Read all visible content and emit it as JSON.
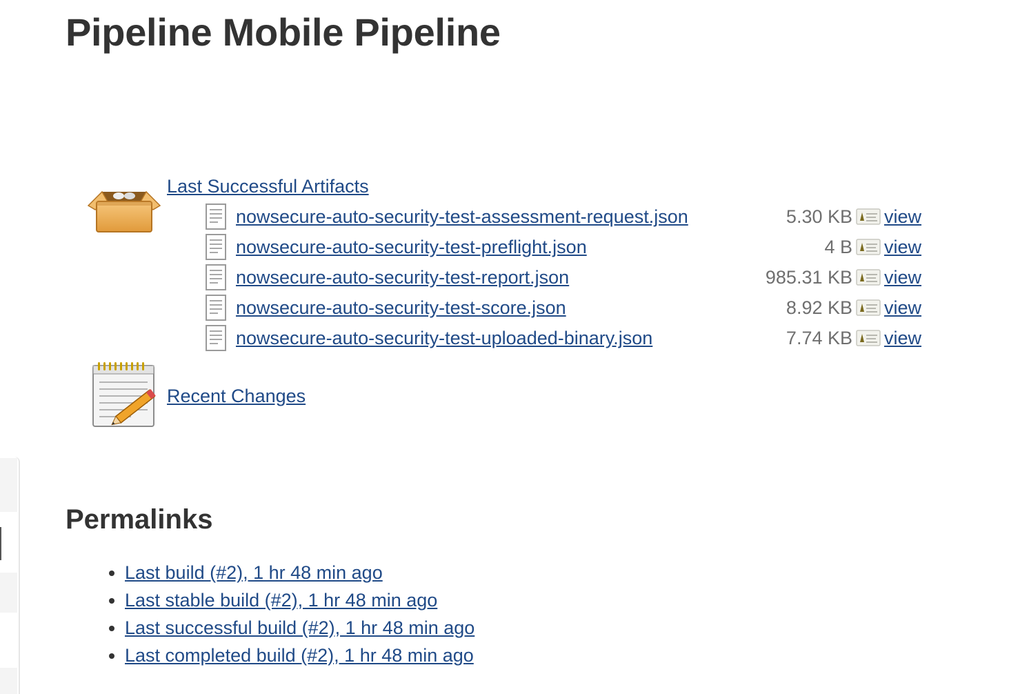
{
  "page": {
    "title": "Pipeline Mobile Pipeline"
  },
  "artifacts": {
    "section_label": "Last Successful Artifacts",
    "icon": "package-box-icon",
    "files": [
      {
        "name": "nowsecure-auto-security-test-assessment-request.json",
        "size": "5.30 KB",
        "view_label": "view"
      },
      {
        "name": "nowsecure-auto-security-test-preflight.json",
        "size": "4 B",
        "view_label": "view"
      },
      {
        "name": "nowsecure-auto-security-test-report.json",
        "size": "985.31 KB",
        "view_label": "view"
      },
      {
        "name": "nowsecure-auto-security-test-score.json",
        "size": "8.92 KB",
        "view_label": "view"
      },
      {
        "name": "nowsecure-auto-security-test-uploaded-binary.json",
        "size": "7.74 KB",
        "view_label": "view"
      }
    ]
  },
  "recent_changes": {
    "label": "Recent Changes",
    "icon": "notepad-pencil-icon"
  },
  "permalinks": {
    "heading": "Permalinks",
    "items": [
      {
        "label": "Last build (#2), 1 hr 48 min ago"
      },
      {
        "label": "Last stable build (#2), 1 hr 48 min ago"
      },
      {
        "label": "Last successful build (#2), 1 hr 48 min ago"
      },
      {
        "label": "Last completed build (#2), 1 hr 48 min ago"
      }
    ]
  },
  "colors": {
    "link": "#204a87",
    "heading": "#333333",
    "size_text": "#6f6f6f"
  }
}
